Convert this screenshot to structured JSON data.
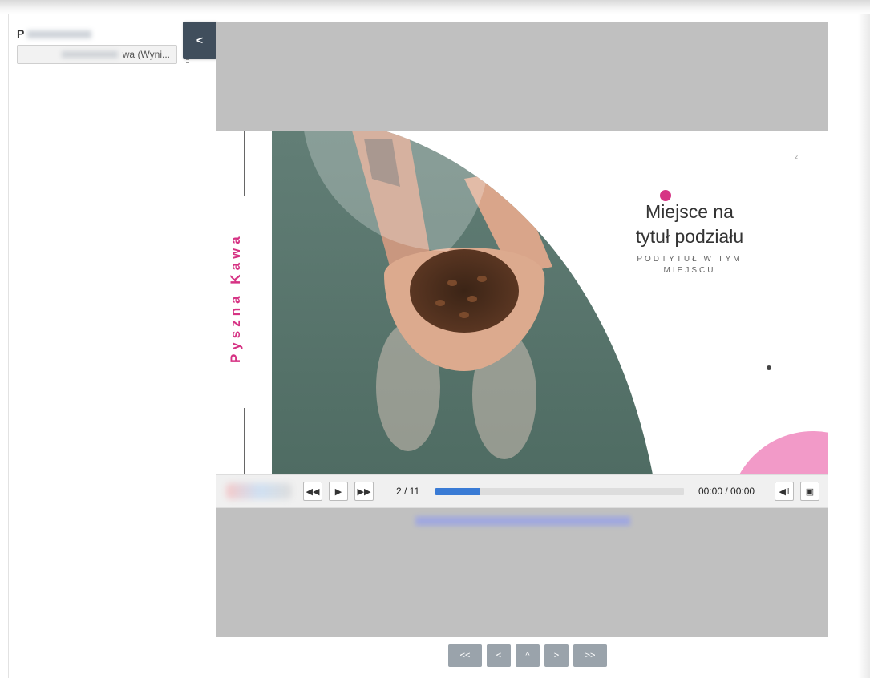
{
  "left_panel": {
    "title_initial": "P",
    "dropdown_value": "wa (Wyni..."
  },
  "collapse_label": "<",
  "slide": {
    "vertical_text": "Pyszna Kawa",
    "slide_number": "2",
    "title_line1": "Miejsce na",
    "title_line2": "tytuł podziału",
    "subtitle": "PODTYTUŁ W TYM MIEJSCU",
    "image": "coffee-beans-in-hands-photo"
  },
  "player": {
    "rewind_icon": "rewind-icon",
    "play_icon": "play-icon",
    "forward_icon": "fast-forward-icon",
    "counter": "2 / 11",
    "progress": 0.18,
    "time": "00:00 / 00:00",
    "volume_icon": "volume-icon",
    "fullscreen_icon": "fullscreen-icon"
  },
  "nav": {
    "first": "<<",
    "prev": "<",
    "up": "^",
    "next": ">",
    "last": ">>"
  },
  "colors": {
    "accent_pink": "#d63384",
    "sidebar_button": "#404e5c",
    "progress": "#3a7bd5",
    "viewer_bg": "#c0c0c0"
  }
}
